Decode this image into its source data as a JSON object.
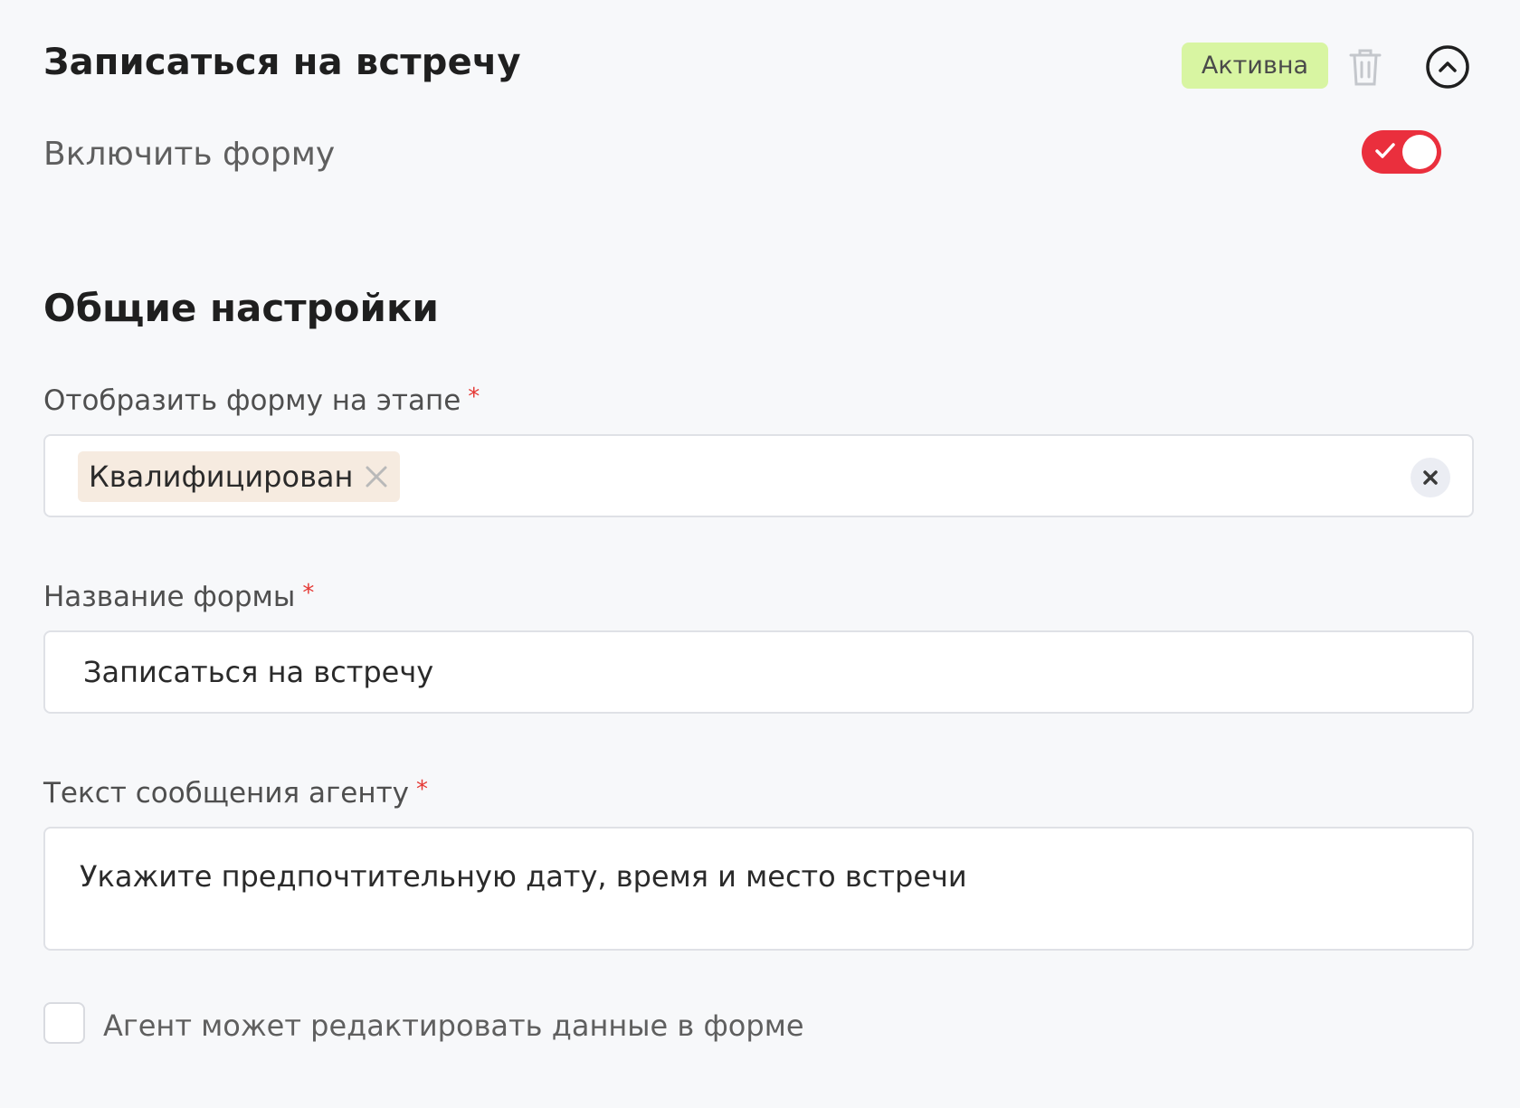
{
  "header": {
    "title": "Записаться на встречу",
    "status_badge": "Активна",
    "delete_icon": "trash-icon",
    "collapse_icon": "chevron-up-circle-icon"
  },
  "enable_form": {
    "label": "Включить форму",
    "toggle_on": true
  },
  "section": {
    "title": "Общие настройки"
  },
  "fields": {
    "stage": {
      "label": "Отобразить форму на этапе",
      "required_mark": "*",
      "selected_tags": [
        "Квалифицирован"
      ]
    },
    "form_name": {
      "label": "Название формы",
      "required_mark": "*",
      "value": "Записаться на встречу"
    },
    "agent_message": {
      "label": "Текст сообщения агенту",
      "required_mark": "*",
      "value": "Укажите предпочтительную дату, время и место встречи"
    }
  },
  "agent_edit_checkbox": {
    "label": "Агент может редактировать данные в форме",
    "checked": false
  },
  "colors": {
    "background": "#f7f8fa",
    "badge_bg": "#d8f5a2",
    "toggle_on": "#ea2f3d",
    "required": "#e53935",
    "tag_bg": "#f6ebe0"
  }
}
